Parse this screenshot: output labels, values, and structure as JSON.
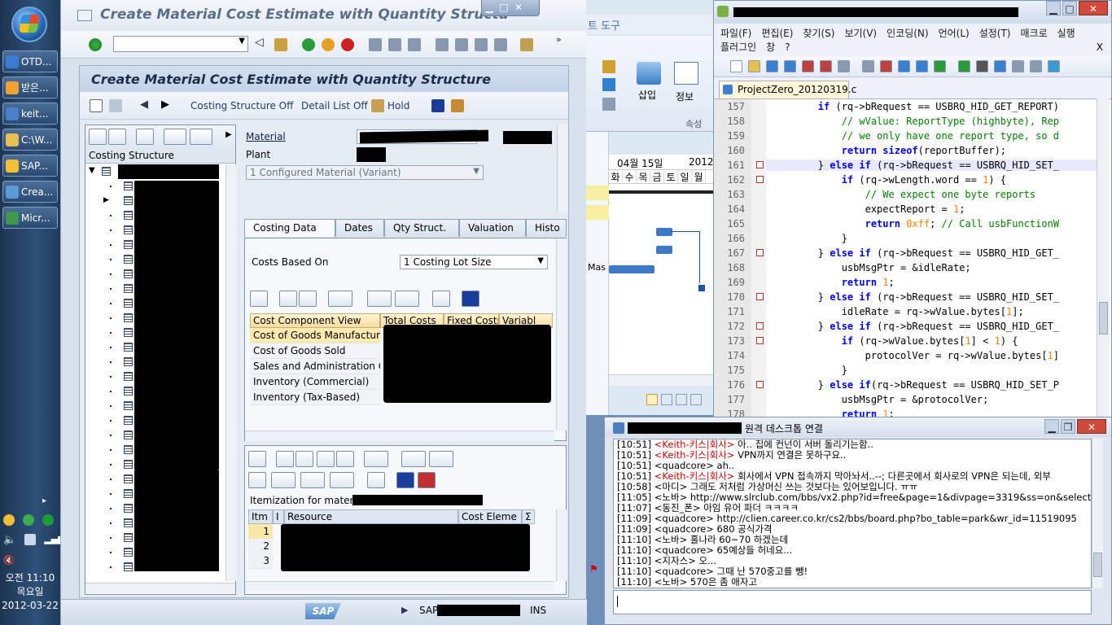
{
  "taskbar": {
    "items": [
      {
        "label": "OTD...",
        "color": "#3a7cd0"
      },
      {
        "label": "받은...",
        "color": "#f0a030"
      },
      {
        "label": "keit...",
        "color": "#4a80c8"
      },
      {
        "label": "C:\\W...",
        "color": "#e8c050"
      },
      {
        "label": "SAP...",
        "color": "#f2c030"
      },
      {
        "label": "Crea...",
        "color": "#5a9ad8"
      },
      {
        "label": "Micr...",
        "color": "#3a9a4a"
      }
    ],
    "clock": {
      "time": "오전 11:10",
      "day": "목요일",
      "date": "2012-03-22"
    }
  },
  "sap": {
    "window_title": "Create Material Cost Estimate with Quantity Structu",
    "screen_title": "Create Material Cost Estimate with Quantity Structure",
    "appbar": {
      "costing_structure_off": "Costing Structure Off",
      "detail_list_off": "Detail List Off",
      "hold": "Hold"
    },
    "tree": {
      "header": "Costing Structure"
    },
    "fields": {
      "material": "Material",
      "plant": "Plant",
      "configured": "1 Configured Material (Variant)"
    },
    "tabs": [
      "Costing Data",
      "Dates",
      "Qty Struct.",
      "Valuation",
      "Histo"
    ],
    "costs_based_on": {
      "label": "Costs Based On",
      "value": "1 Costing Lot Size"
    },
    "cost_grid": {
      "headers": [
        "Cost Component View",
        "Total Costs",
        "Fixed Costs",
        "Variabl"
      ],
      "rows": [
        "Cost of Goods Manufactured",
        "Cost of Goods Sold",
        "Sales and Administration Costs",
        "Inventory (Commercial)",
        "Inventory (Tax-Based)"
      ]
    },
    "itemization": {
      "label": "Itemization for material",
      "headers": [
        "Itm",
        "I",
        "Resource",
        "Cost Eleme",
        "Σ"
      ],
      "rows": [
        "1",
        "2",
        "3"
      ]
    },
    "status": {
      "sap": "SAP",
      "mode": "INS"
    }
  },
  "office": {
    "ribbon_fragment": "트 도구",
    "insert": "삽입",
    "info": "정보",
    "attr": "속성",
    "date": "04월 15일",
    "year": "2012",
    "days": [
      "화",
      "수",
      "목",
      "금",
      "토",
      "일",
      "월"
    ],
    "bar_label": "Mas"
  },
  "npp": {
    "menu": [
      "파일(F)",
      "편집(E)",
      "찾기(S)",
      "보기(V)",
      "인코딩(N)",
      "언어(L)",
      "설정(T)",
      "매크로",
      "실행",
      "플러그인",
      "창",
      "?"
    ],
    "tab": "ProjectZero_20120319.c",
    "lines": [
      {
        "n": "157",
        "code": "        if (rq->bRequest == USBRQ_HID_GET_REPORT)"
      },
      {
        "n": "158",
        "code": "            // wValue: ReportType (highbyte), Rep"
      },
      {
        "n": "159",
        "code": "            // we only have one report type, so d"
      },
      {
        "n": "160",
        "code": "            return sizeof(reportBuffer);"
      },
      {
        "n": "161",
        "code": "        } else if (rq->bRequest == USBRQ_HID_SET_"
      },
      {
        "n": "162",
        "code": "            if (rq->wLength.word == 1) {"
      },
      {
        "n": "163",
        "code": "                // We expect one byte reports"
      },
      {
        "n": "164",
        "code": "                expectReport = 1;"
      },
      {
        "n": "165",
        "code": "                return 0xff; // Call usbFunctionW"
      },
      {
        "n": "166",
        "code": "            }"
      },
      {
        "n": "167",
        "code": "        } else if (rq->bRequest == USBRQ_HID_GET_"
      },
      {
        "n": "168",
        "code": "            usbMsgPtr = &idleRate;"
      },
      {
        "n": "169",
        "code": "            return 1;"
      },
      {
        "n": "170",
        "code": "        } else if (rq->bRequest == USBRQ_HID_SET_"
      },
      {
        "n": "171",
        "code": "            idleRate = rq->wValue.bytes[1];"
      },
      {
        "n": "172",
        "code": "        } else if (rq->bRequest == USBRQ_HID_GET_"
      },
      {
        "n": "173",
        "code": "            if (rq->wValue.bytes[1] < 1) {"
      },
      {
        "n": "174",
        "code": "                protocolVer = rq->wValue.bytes[1]"
      },
      {
        "n": "175",
        "code": "            }"
      },
      {
        "n": "176",
        "code": "        } else if(rq->bRequest == USBRQ_HID_SET_P"
      },
      {
        "n": "177",
        "code": "            usbMsgPtr = &protocolVer;"
      },
      {
        "n": "178",
        "code": "            return 1;"
      }
    ]
  },
  "chat": {
    "title": "원격 데스크톱 연결",
    "messages": [
      {
        "t": "[10:51]",
        "who": "<Keith-키스|회사>",
        "red": true,
        "msg": " 아.. 집에 컨넌이 서버 돌리기는함.."
      },
      {
        "t": "[10:51]",
        "who": "<Keith-키스|회사>",
        "red": true,
        "msg": " VPN까지 연결은 못하구요.."
      },
      {
        "t": "[10:51]",
        "who": "<quadcore>",
        "red": false,
        "msg": " ah.."
      },
      {
        "t": "[10:51]",
        "who": "<Keith-키스|회사>",
        "red": true,
        "msg": " 회사에서 VPN 접속까지 막아놔서..--; 다른곳에서 회사로의 VPN은 되는데, 외부"
      },
      {
        "t": "[10:58]",
        "who": "<마디>",
        "red": false,
        "msg": " 그래도 저처럼 가상머신 쓰는 것보다는 있어보입니다. ㅠㅠ"
      },
      {
        "t": "[11:05]",
        "who": "<노바>",
        "red": false,
        "msg": " http://www.slrclub.com/bbs/vx2.php?id=free&page=1&divpage=3319&ss=on&select_arra"
      },
      {
        "t": "[11:07]",
        "who": "<동진_폰>",
        "red": false,
        "msg": " 아임 유어 파더 ㅋㅋㅋㅋ"
      },
      {
        "t": "[11:09]",
        "who": "<quadcore>",
        "red": false,
        "msg": " http://clien.career.co.kr/cs2/bbs/board.php?bo_table=park&wr_id=11519095"
      },
      {
        "t": "[11:09]",
        "who": "<quadcore>",
        "red": false,
        "msg": " 680 공식가격"
      },
      {
        "t": "[11:10]",
        "who": "<노바>",
        "red": false,
        "msg": " 홀나라 60~70 하겠는데"
      },
      {
        "t": "[11:10]",
        "who": "<quadcore>",
        "red": false,
        "msg": " 65예상들 허네요..."
      },
      {
        "t": "[11:10]",
        "who": "<지자스>",
        "red": false,
        "msg": " 오..."
      },
      {
        "t": "[11:10]",
        "who": "<quadcore>",
        "red": false,
        "msg": " 그때 난 570중고를 뺑!"
      },
      {
        "t": "[11:10]",
        "who": "<노바>",
        "red": false,
        "msg": " 570은 좀 애자고"
      }
    ]
  }
}
